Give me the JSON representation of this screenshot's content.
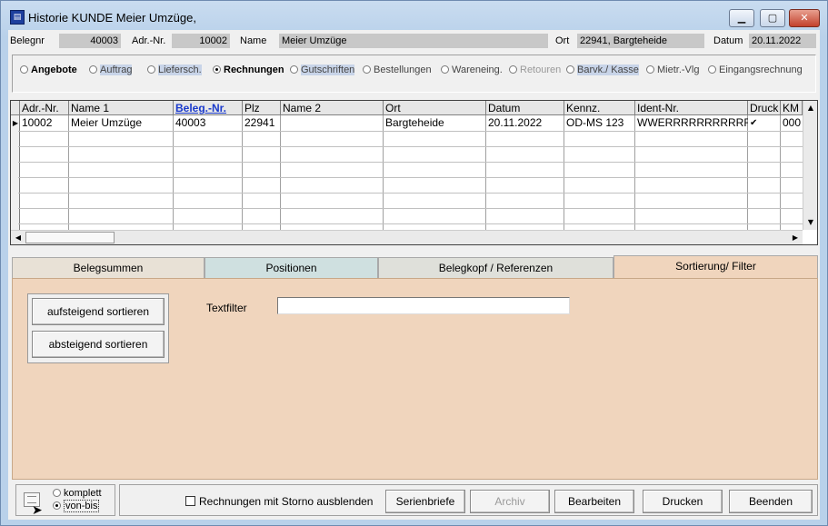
{
  "window": {
    "title": "Historie KUNDE Meier Umzüge,"
  },
  "header": {
    "belegnr_label": "Belegnr",
    "belegnr_value": "40003",
    "adrnr_label": "Adr.-Nr.",
    "adrnr_value": "10002",
    "name_label": "Name",
    "name_value": "Meier Umzüge",
    "ort_label": "Ort",
    "ort_value": "22941, Bargteheide",
    "datum_label": "Datum",
    "datum_value": "20.11.2022"
  },
  "doc_types": [
    {
      "label": "Angebote",
      "selected": false
    },
    {
      "label": "Auftrag",
      "selected": false
    },
    {
      "label": "Liefersch.",
      "selected": false
    },
    {
      "label": "Rechnungen",
      "selected": true
    },
    {
      "label": "Gutschriften",
      "selected": false
    },
    {
      "label": "Bestellungen",
      "selected": false
    },
    {
      "label": "Wareneing.",
      "selected": false
    },
    {
      "label": "Retouren",
      "selected": false
    },
    {
      "label": "Barvk./ Kasse",
      "selected": false
    },
    {
      "label": "Mietr.-Vlg",
      "selected": false
    },
    {
      "label": "Eingangsrechnung",
      "selected": false
    }
  ],
  "grid": {
    "columns": [
      "Adr.-Nr.",
      "Name 1",
      "Beleg.-Nr.",
      "Plz",
      "Name 2",
      "Ort",
      "Datum",
      "Kennz.",
      "Ident-Nr.",
      "Druck",
      "KM"
    ],
    "rows": [
      {
        "adrnr": "10002",
        "name1": "Meier Umzüge",
        "belegnr": "40003",
        "plz": "22941",
        "name2": "",
        "ort": "Bargteheide",
        "datum": "20.11.2022",
        "kennz": "OD-MS 123",
        "identnr": "WWERRRRRRRRRRRR",
        "druck": "✔",
        "km": "000"
      }
    ]
  },
  "tabs": [
    "Belegsummen",
    "Positionen",
    "Belegkopf / Referenzen",
    "Sortierung/ Filter"
  ],
  "sort_panel": {
    "asc_label": "aufsteigend sortieren",
    "desc_label": "absteigend sortieren",
    "textfilter_label": "Textfilter",
    "textfilter_value": ""
  },
  "view_mode": {
    "komplett": "komplett",
    "von_bis": "von-bis",
    "selected": "von-bis"
  },
  "footer": {
    "storno_checkbox": "Rechnungen mit Storno ausblenden",
    "serienbriefe": "Serienbriefe",
    "archiv": "Archiv",
    "bearbeiten": "Bearbeiten",
    "drucken": "Drucken",
    "beenden": "Beenden"
  },
  "colors": {
    "panel_bg": "#f0d5bd",
    "tab_active": "#f0d5bd",
    "tab_positionen": "#cfe0e0",
    "link": "#1a3acc"
  }
}
